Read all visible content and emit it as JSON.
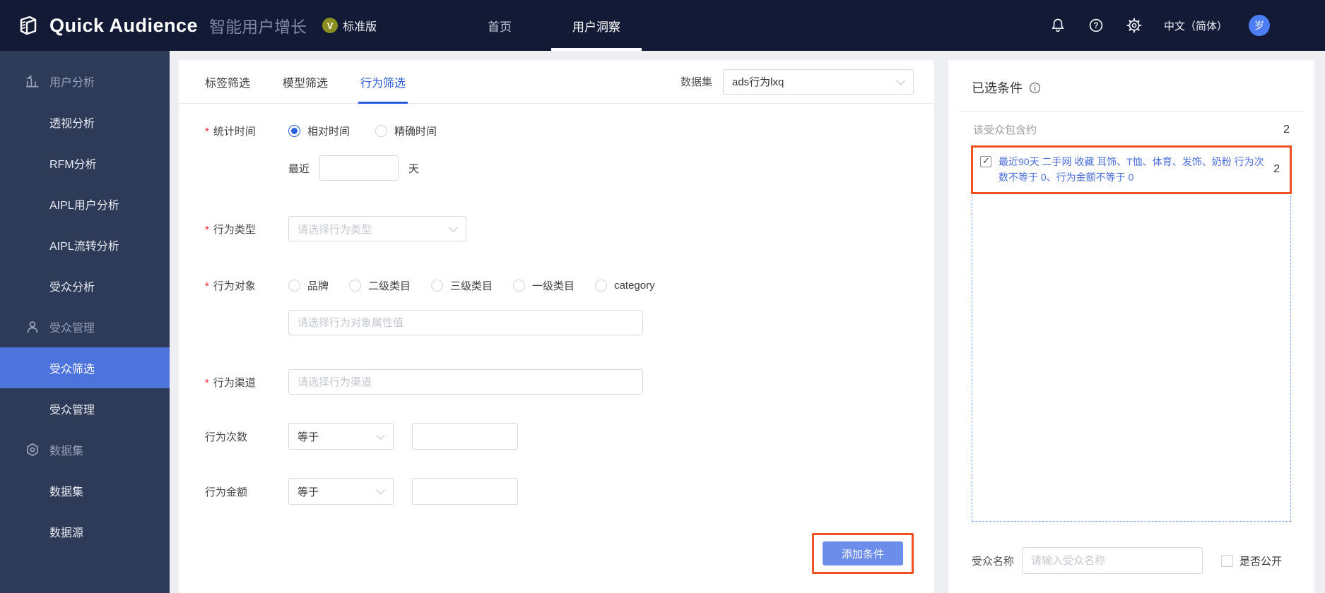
{
  "topbar": {
    "logo_text": "Quick Audience",
    "product_name": "智能用户增长",
    "badge_letter": "V",
    "edition": "标准版",
    "nav_home": "首页",
    "nav_insight": "用户洞察",
    "language": "中文（简体）",
    "avatar_text": "岁",
    "icons": {
      "notification": "bell-icon",
      "help": "question-circle-icon",
      "settings": "gear-icon"
    }
  },
  "sidebar": {
    "sections": [
      {
        "label": "用户分析",
        "icon": "bar-chart-icon",
        "items": [
          "透视分析",
          "RFM分析",
          "AIPL用户分析",
          "AIPL流转分析",
          "受众分析"
        ]
      },
      {
        "label": "受众管理",
        "icon": "user-icon",
        "items": [
          "受众筛选",
          "受众管理"
        ],
        "active_item": "受众筛选"
      },
      {
        "label": "数据集",
        "icon": "hexagon-nut-icon",
        "items": [
          "数据集",
          "数据源"
        ]
      }
    ]
  },
  "main": {
    "tabs": {
      "tag": "标签筛选",
      "model": "模型筛选",
      "behavior": "行为筛选",
      "active": "行为筛选"
    },
    "dataset_label": "数据集",
    "dataset_value": "ads行为lxq",
    "form": {
      "stat_time_label": "统计时间",
      "relative_time": "相对时间",
      "exact_time": "精确时间",
      "time_selected": "相对时间",
      "recent_label": "最近",
      "recent_value": "",
      "day_unit": "天",
      "behavior_type_label": "行为类型",
      "behavior_type_placeholder": "请选择行为类型",
      "behavior_object_label": "行为对象",
      "object_options": [
        "品牌",
        "二级类目",
        "三级类目",
        "一级类目",
        "category"
      ],
      "object_placeholder": "请选择行为对象属性值",
      "channel_label": "行为渠道",
      "channel_placeholder": "请选择行为渠道",
      "count_label": "行为次数",
      "count_operator": "等于",
      "count_value": "",
      "amount_label": "行为金额",
      "amount_operator": "等于",
      "amount_value": "",
      "add_condition_button": "添加条件"
    }
  },
  "right_panel": {
    "title": "已选条件",
    "summary_label": "该受众包含约",
    "summary_count": "2",
    "condition": {
      "checked": true,
      "text": "最近90天 二手网 收藏 耳饰、T恤、体育、发饰、奶粉 行为次数不等于 0、行为金额不等于 0",
      "count": "2"
    },
    "audience_name_label": "受众名称",
    "audience_name_placeholder": "请输入受众名称",
    "public_label": "是否公开",
    "public_checked": false
  },
  "colors": {
    "topbar_bg": "#121a35",
    "sidebar_bg": "#2d3a58",
    "active_item_bg": "#4d73dd",
    "accent_blue": "#2b5cd9",
    "link_blue": "#4a6fdc",
    "button_blue": "#6c8de9",
    "annotation_orange": "#f05123",
    "badge_olive": "#8b8e20",
    "avatar_blue": "#4c7df2"
  }
}
